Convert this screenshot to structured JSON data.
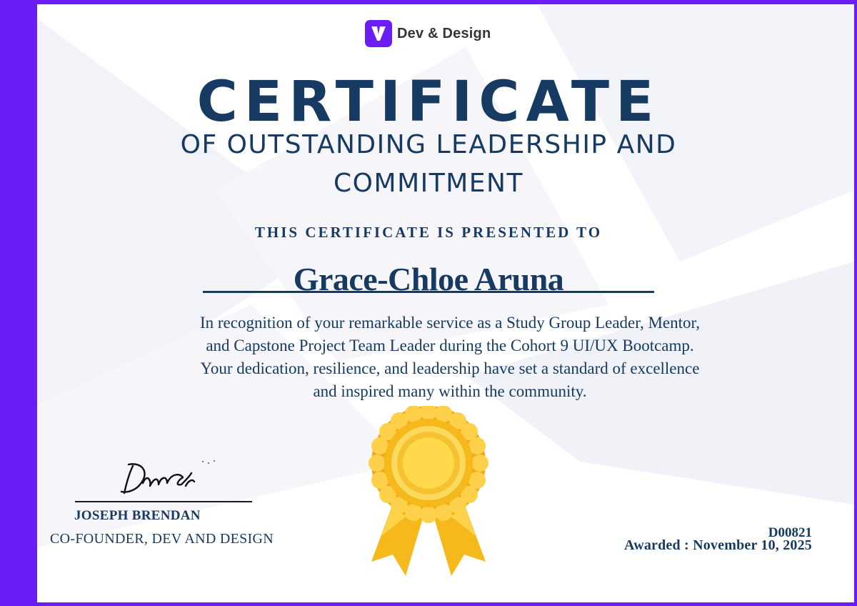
{
  "brand": {
    "name_part1": "Dev",
    "ampersand": "&",
    "name_part2": "Design",
    "icon": "v-logo-icon"
  },
  "certificate": {
    "title": "CERTIFICATE",
    "subtitle_line1": "OF OUTSTANDING LEADERSHIP AND",
    "subtitle_line2": "COMMITMENT",
    "presented_to": "THIS CERTIFICATE IS PRESENTED TO",
    "recipient": "Grace-Chloe Aruna",
    "body_line1": "In recognition of your remarkable service as a Study Group Leader, Mentor,",
    "body_line2": "and Capstone Project Team Leader during the Cohort 9 UI/UX Bootcamp.",
    "body_line3": "Your dedication, resilience, and leadership have set a standard of excellence",
    "body_line4": "and inspired many within the community."
  },
  "signer": {
    "name": "JOSEPH BRENDAN",
    "role": "CO-FOUNDER, DEV AND DESIGN"
  },
  "meta": {
    "certificate_id": "D00821",
    "awarded": "Awarded : November 10, 2025"
  },
  "colors": {
    "accent": "#6a1ef5",
    "navy": "#173a63",
    "gold": "#f6c232"
  }
}
